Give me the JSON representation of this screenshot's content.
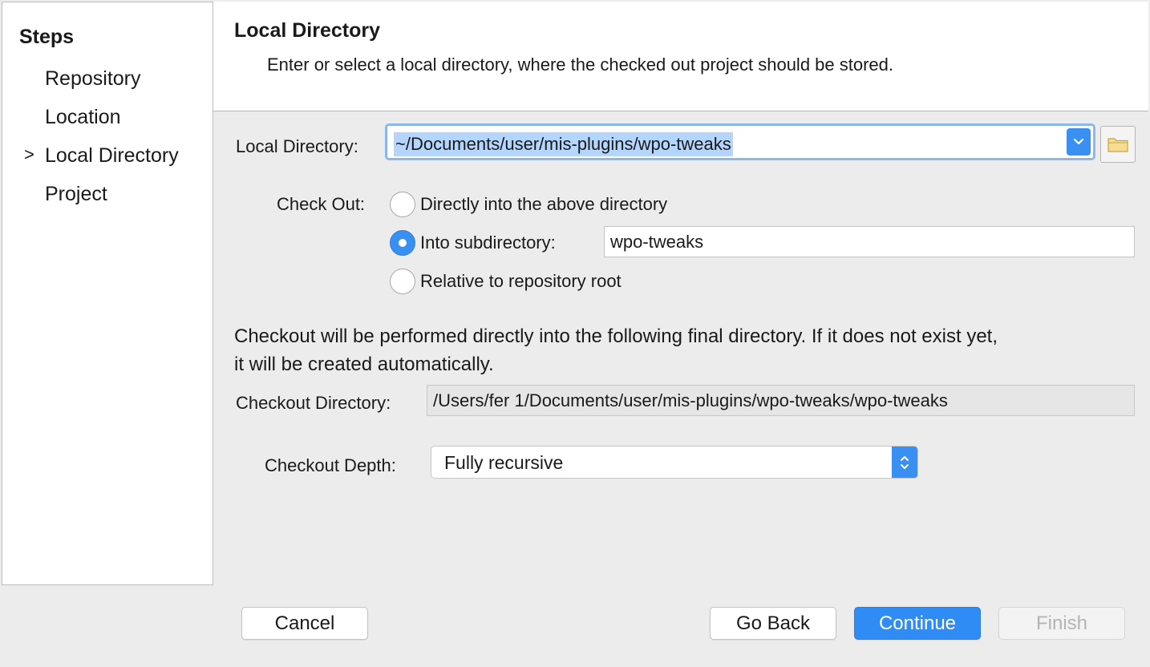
{
  "sidebar": {
    "title": "Steps",
    "items": [
      {
        "label": "Repository"
      },
      {
        "label": "Location"
      },
      {
        "label": "Local Directory"
      },
      {
        "label": "Project"
      }
    ],
    "current_marker": ">"
  },
  "header": {
    "title": "Local Directory",
    "description": "Enter or select a local directory, where the checked out project should be stored."
  },
  "form": {
    "local_directory_label": "Local Directory:",
    "local_directory_value": "~/Documents/user/mis-plugins/wpo-tweaks",
    "checkout_label": "Check Out:",
    "options": [
      {
        "label": "Directly into the above directory",
        "checked": false
      },
      {
        "label": "Into subdirectory:",
        "checked": true
      },
      {
        "label": "Relative to repository root",
        "checked": false
      }
    ],
    "subdirectory_value": "wpo-tweaks",
    "info_line1": "Checkout will be performed directly into the following final directory. If it does not exist yet,",
    "info_line2": "it will be created automatically.",
    "checkout_directory_label": "Checkout Directory:",
    "checkout_directory_value": "/Users/fer 1/Documents/user/mis-plugins/wpo-tweaks/wpo-tweaks",
    "depth_label": "Checkout Depth:",
    "depth_value": "Fully recursive"
  },
  "buttons": {
    "cancel": "Cancel",
    "go_back": "Go Back",
    "continue": "Continue",
    "finish": "Finish"
  },
  "colors": {
    "accent": "#3a8ff2",
    "selection": "#b4d5fd",
    "window_bg": "#ececec"
  }
}
